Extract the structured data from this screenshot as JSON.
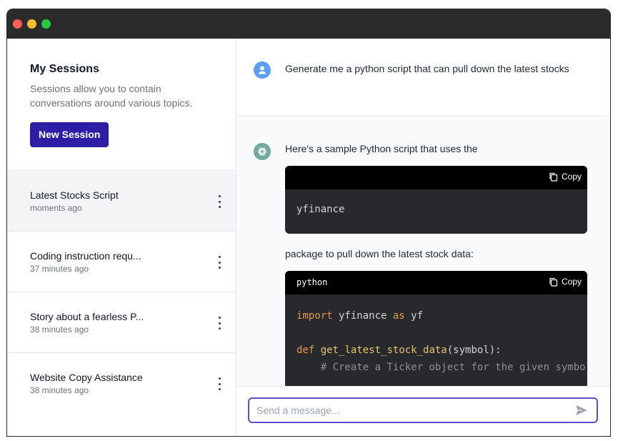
{
  "window": {
    "traffic_lights": [
      "close",
      "minimize",
      "zoom"
    ]
  },
  "sidebar": {
    "title": "My Sessions",
    "description": "Sessions allow you to contain conversations around various topics.",
    "new_session_label": "New Session",
    "sessions": [
      {
        "title": "Latest Stocks Script",
        "time": "moments ago",
        "active": true
      },
      {
        "title": "Coding instruction requ...",
        "time": "37 minutes ago",
        "active": false
      },
      {
        "title": "Story about a fearless P...",
        "time": "38 minutes ago",
        "active": false
      },
      {
        "title": "Website Copy Assistance",
        "time": "38 minutes ago",
        "active": false
      }
    ]
  },
  "chat": {
    "user_message": "Generate me a python script that can pull down the latest stocks",
    "ai_intro": "Here's a sample Python script that uses the",
    "code_block_1": {
      "lang": "",
      "copy_label": "Copy",
      "code": "yfinance"
    },
    "ai_middle": "package to pull down the latest stock data:",
    "code_block_2": {
      "lang": "python",
      "copy_label": "Copy",
      "line1_kw": "import",
      "line1_mid": " yfinance ",
      "line1_kw2": "as",
      "line1_end": " yf",
      "line3_kw": "def",
      "line3_fn": "get_latest_stock_data",
      "line3_end": "(symbol):",
      "line4_comment": "# Create a Ticker object for the given symbol"
    },
    "composer": {
      "placeholder": "Send a message..."
    }
  },
  "colors": {
    "accent": "#2e1ea6",
    "input_border": "#5b4fc7",
    "user_avatar": "#5b9ff3",
    "ai_avatar": "#74aa9c"
  }
}
